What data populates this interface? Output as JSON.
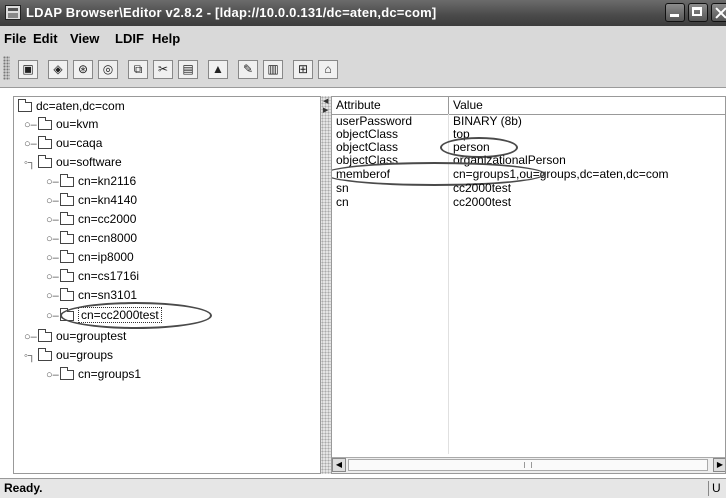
{
  "window": {
    "title": "LDAP Browser\\Editor v2.8.2 - [ldap://10.0.0.131/dc=aten,dc=com]"
  },
  "menu": [
    {
      "label": "File"
    },
    {
      "label": "Edit"
    },
    {
      "label": "View"
    },
    {
      "label": "LDIF"
    },
    {
      "label": "Help"
    }
  ],
  "toolbar": {
    "buttons": [
      {
        "icon": "connect-icon",
        "glyph": "▣"
      },
      {
        "icon": "reconnect-icon",
        "glyph": "◈"
      },
      {
        "icon": "refresh-icon",
        "glyph": "⊛"
      },
      {
        "icon": "search-icon",
        "glyph": "◎"
      },
      {
        "icon": "copy-icon",
        "glyph": "⧉"
      },
      {
        "icon": "cut-icon",
        "glyph": "✂"
      },
      {
        "icon": "paste-icon",
        "glyph": "▤"
      },
      {
        "icon": "up-icon",
        "glyph": "▲"
      },
      {
        "icon": "edit-icon",
        "glyph": "✎"
      },
      {
        "icon": "delete-icon",
        "glyph": "▥"
      },
      {
        "icon": "tree-icon",
        "glyph": "⊞"
      },
      {
        "icon": "home-icon",
        "glyph": "⌂"
      }
    ]
  },
  "tree": {
    "root": "dc=aten,dc=com",
    "nodes": [
      {
        "label": "ou=kvm",
        "expanded": false
      },
      {
        "label": "ou=caqa",
        "expanded": false
      },
      {
        "label": "ou=software",
        "expanded": true
      },
      {
        "label": "cn=kn2116",
        "expanded": false
      },
      {
        "label": "cn=kn4140",
        "expanded": false
      },
      {
        "label": "cn=cc2000",
        "expanded": false
      },
      {
        "label": "cn=cn8000",
        "expanded": false
      },
      {
        "label": "cn=ip8000",
        "expanded": false
      },
      {
        "label": "cn=cs1716i",
        "expanded": false
      },
      {
        "label": "cn=sn3101",
        "expanded": false
      },
      {
        "label": "cn=cc2000test",
        "expanded": false,
        "selected": true
      },
      {
        "label": "ou=grouptest",
        "expanded": false
      },
      {
        "label": "ou=groups",
        "expanded": true
      },
      {
        "label": "cn=groups1",
        "expanded": false
      }
    ]
  },
  "attributes": {
    "header": {
      "attribute": "Attribute",
      "value": "Value"
    },
    "rows": [
      {
        "attribute": "userPassword",
        "value": "BINARY (8b)"
      },
      {
        "attribute": "objectClass",
        "value": "top"
      },
      {
        "attribute": "objectClass",
        "value": "person"
      },
      {
        "attribute": "objectClass",
        "value": "organizationalPerson"
      },
      {
        "attribute": "memberof",
        "value": "cn=groups1,ou=groups,dc=aten,dc=com"
      },
      {
        "attribute": "sn",
        "value": "cc2000test"
      },
      {
        "attribute": "cn",
        "value": "cc2000test"
      }
    ]
  },
  "status": {
    "text": "Ready.",
    "right": "U"
  }
}
